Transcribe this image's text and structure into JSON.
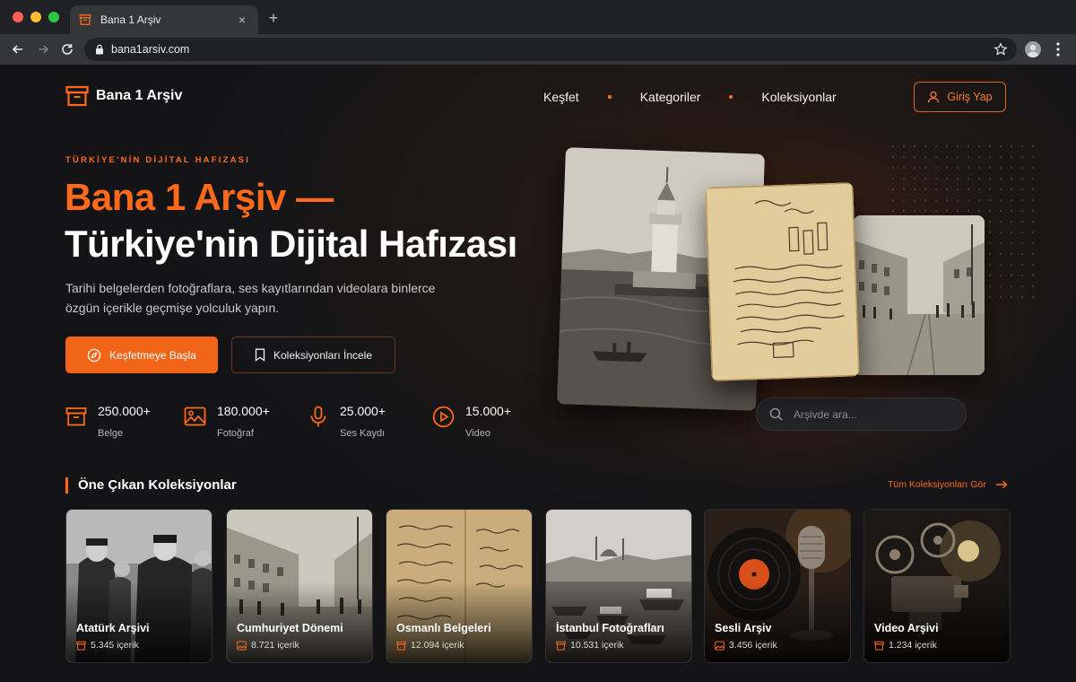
{
  "browser": {
    "tab_title": "Bana 1 Arşiv",
    "tab_close": "×",
    "new_tab": "+",
    "url": "bana1arsiv.com"
  },
  "header": {
    "logo_text": "Bana 1 Arşiv",
    "nav": [
      "Keşfet",
      "Kategoriler",
      "Koleksiyonlar"
    ],
    "login_label": "Giriş Yap"
  },
  "hero": {
    "eyebrow": "TÜRKİYE'NİN DİJİTAL HAFIZASI",
    "title_line1": "Bana 1 Arşiv —",
    "title_line2": "Türkiye'nin Dijital Hafızası",
    "lead": "Tarihi belgelerden fotoğraflara, ses kayıtlarından videolara binlerce özgün içerikle geçmişe yolculuk yapın.",
    "primary_button": "Keşfetmeye Başla",
    "secondary_button": "Koleksiyonları İncele",
    "search_placeholder": "Arşivde ara...",
    "accent_color": "#ff6a1a"
  },
  "stats": [
    {
      "value": "250.000+",
      "label": "Belge",
      "icon": "archive-box-icon"
    },
    {
      "value": "180.000+",
      "label": "Fotoğraf",
      "icon": "image-icon"
    },
    {
      "value": "25.000+",
      "label": "Ses Kaydı",
      "icon": "microphone-icon"
    },
    {
      "value": "15.000+",
      "label": "Video",
      "icon": "play-circle-icon"
    }
  ],
  "collections": {
    "title": "Öne Çıkan Koleksiyonlar",
    "see_all": "Tüm Koleksiyonları Gör",
    "items": [
      {
        "title": "Atatürk Arşivi",
        "count": "5.345 içerik"
      },
      {
        "title": "Cumhuriyet Dönemi",
        "count": "8.721 içerik"
      },
      {
        "title": "Osmanlı Belgeleri",
        "count": "12.094 içerik"
      },
      {
        "title": "İstanbul Fotoğrafları",
        "count": "10.531 içerik"
      },
      {
        "title": "Sesli Arşiv",
        "count": "3.456 içerik"
      },
      {
        "title": "Video Arşivi",
        "count": "1.234 içerik"
      }
    ]
  }
}
